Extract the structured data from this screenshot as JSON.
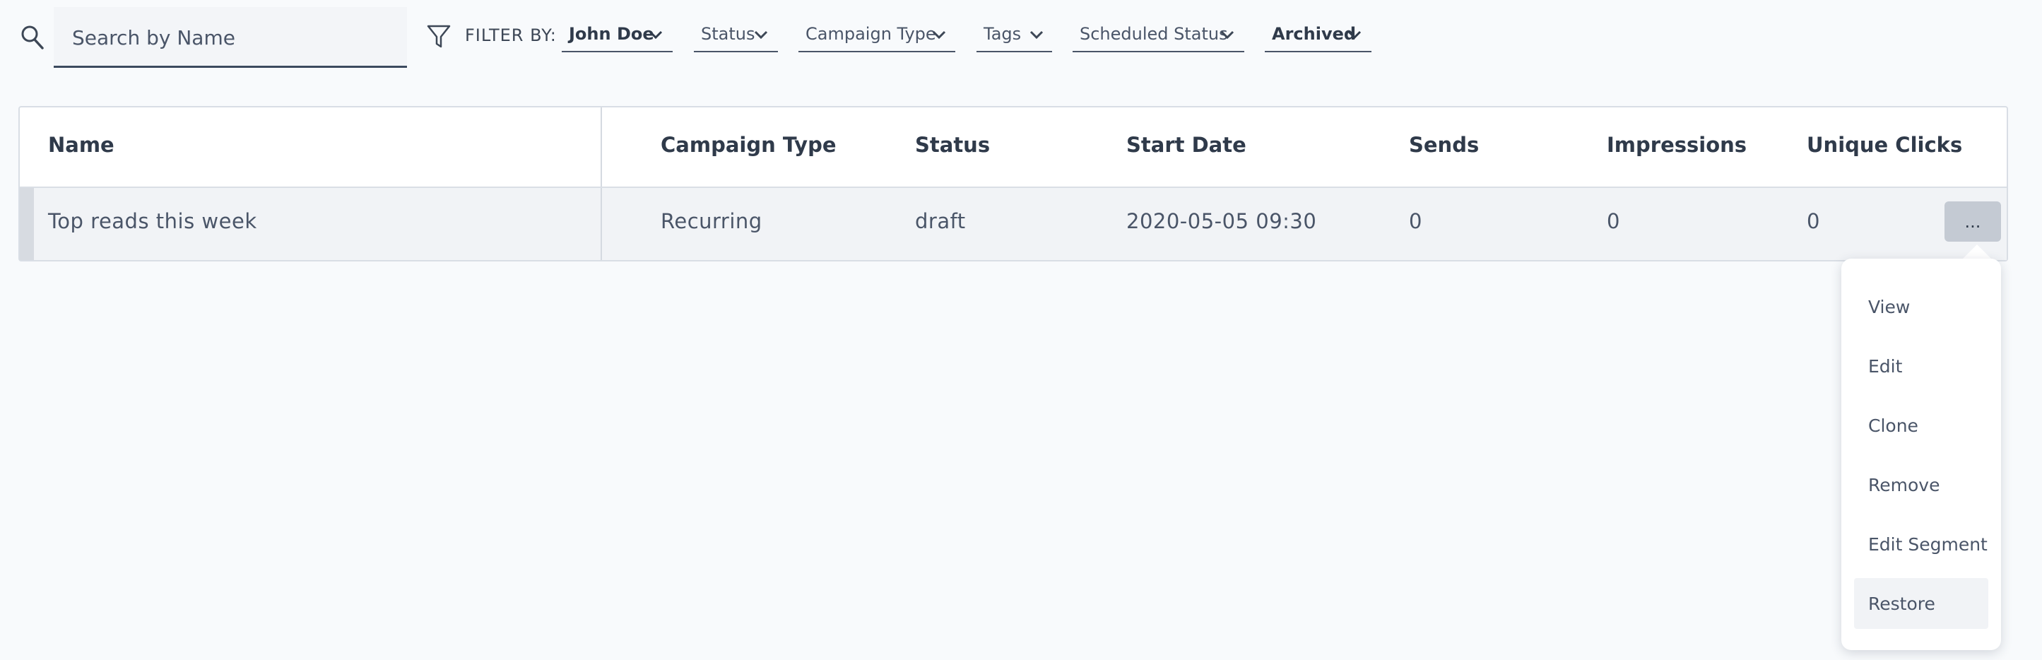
{
  "search": {
    "placeholder": "Search by Name",
    "value": ""
  },
  "filters": {
    "label": "FILTER BY:",
    "items": [
      {
        "label": "John Doe",
        "active": true
      },
      {
        "label": "Status",
        "active": false
      },
      {
        "label": "Campaign Type",
        "active": false
      },
      {
        "label": "Tags",
        "active": false
      },
      {
        "label": "Scheduled Status",
        "active": false
      },
      {
        "label": "Archived",
        "active": true
      }
    ]
  },
  "table": {
    "columns": [
      "Name",
      "Campaign Type",
      "Status",
      "Start Date",
      "Sends",
      "Impressions",
      "Unique Clicks"
    ],
    "rows": [
      {
        "name": "Top reads this week",
        "campaign_type": "Recurring",
        "status": "draft",
        "start_date": "2020-05-05 09:30",
        "sends": "0",
        "impressions": "0",
        "unique_clicks": "0"
      }
    ],
    "more_label": "..."
  },
  "menu": {
    "items": [
      "View",
      "Edit",
      "Clone",
      "Remove",
      "Edit Segment",
      "Restore"
    ],
    "highlighted": "Restore"
  },
  "colors": {
    "accent_border": "#3b4a5e",
    "button_gray": "#c4cad3",
    "row_bg": "#f1f3f6"
  }
}
